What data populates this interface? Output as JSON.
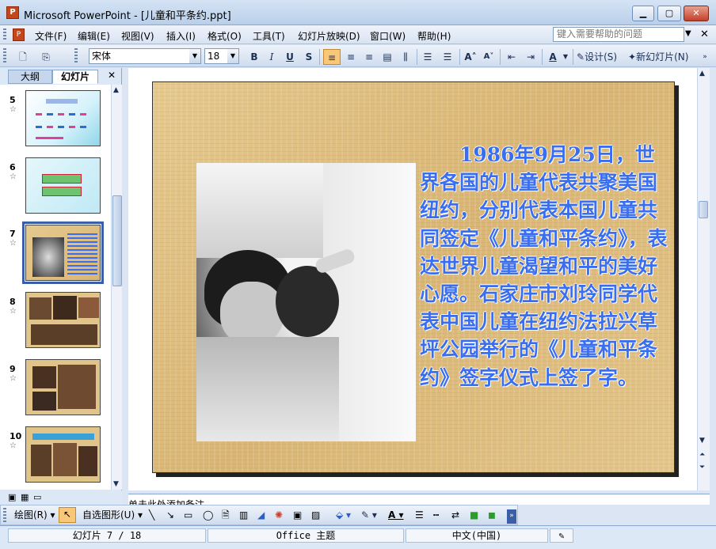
{
  "window": {
    "title": "Microsoft PowerPoint - [儿童和平条约.ppt]"
  },
  "menu": [
    "文件(F)",
    "编辑(E)",
    "视图(V)",
    "插入(I)",
    "格式(O)",
    "工具(T)",
    "幻灯片放映(D)",
    "窗口(W)",
    "帮助(H)"
  ],
  "help_placeholder": "键入需要帮助的问题",
  "toolbar": {
    "font": "宋体",
    "size": "18",
    "bold": "B",
    "italic": "I",
    "underline": "U",
    "shadow": "S",
    "design_label": "设计(S)",
    "new_slide_label": "新幻灯片(N)"
  },
  "panes": {
    "outline_tab": "大纲",
    "slides_tab": "幻灯片"
  },
  "thumbnails": [
    {
      "num": "5"
    },
    {
      "num": "6"
    },
    {
      "num": "7"
    },
    {
      "num": "8"
    },
    {
      "num": "9"
    },
    {
      "num": "10"
    }
  ],
  "slide": {
    "text": "　　1986年9月25日，世界各国的儿童代表共聚美国纽约，分别代表本国儿童共同签定《儿童和平条约》，表达世界儿童渴望和平的美好心愿。石家庄市刘玲同学代表中国儿童在纽约法拉兴草坪公园举行的《儿童和平条约》签字仪式上签了字。",
    "text_color": "#3a6ef0"
  },
  "notes_placeholder": "单击此处添加备注",
  "drawing": {
    "draw_label": "绘图(R)",
    "autoshape_label": "自选图形(U)"
  },
  "status": {
    "slide_pos": "幻灯片 7 / 18",
    "theme": "Office 主题",
    "language": "中文(中国)"
  }
}
